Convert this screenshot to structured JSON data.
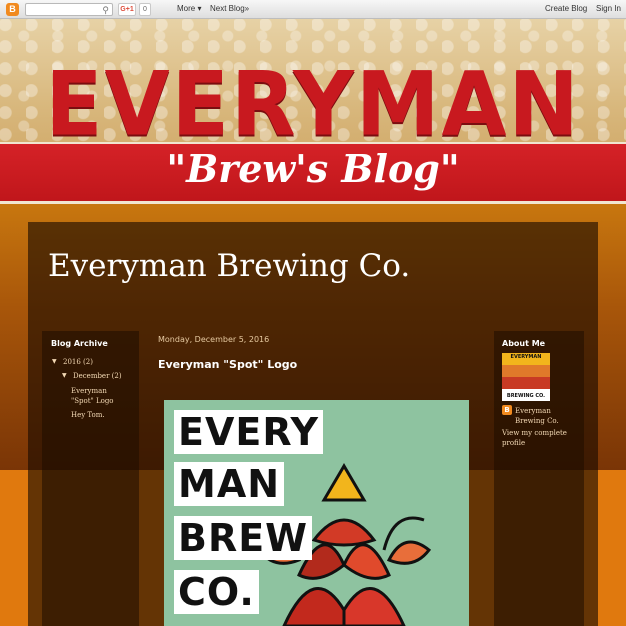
{
  "navbar": {
    "gplus_label": "G+1",
    "gplus_count": "0",
    "more_label": "More ▾",
    "next_blog_label": "Next Blog»",
    "create_blog_label": "Create Blog",
    "sign_in_label": "Sign In"
  },
  "banner": {
    "title": "EVERYMAN",
    "subtitle": "\"Brew's Blog\""
  },
  "blog": {
    "title": "Everyman Brewing Co."
  },
  "archive": {
    "heading": "Blog Archive",
    "year_label": "2016 (2)",
    "month_label": "December (2)",
    "posts": [
      "Everyman \"Spot\" Logo",
      "Hey Tom."
    ]
  },
  "post": {
    "date": "Monday, December 5, 2016",
    "title": "Everyman \"Spot\" Logo",
    "image_words": [
      "EVERY",
      "MAN",
      "BREW",
      "CO."
    ]
  },
  "about": {
    "heading": "About Me",
    "profile_name": "Everyman Brewing Co.",
    "view_profile_label": "View my complete profile",
    "thumb_top": "EVERYMAN",
    "thumb_bottom": "BREWING CO."
  },
  "colors": {
    "brand_red": "#c8191f",
    "accent_orange": "#e0790e",
    "logo_green": "#8ec3a0"
  }
}
